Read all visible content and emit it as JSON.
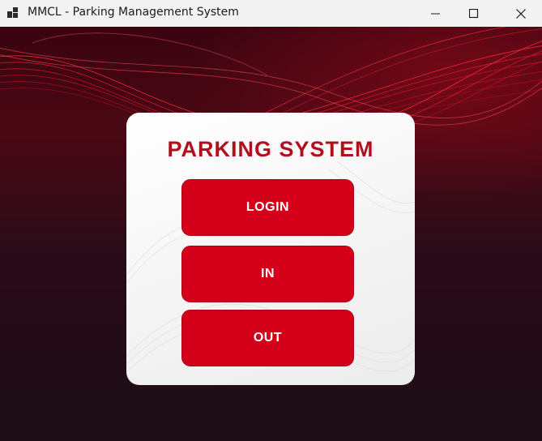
{
  "window": {
    "title": "MMCL - Parking Management System",
    "controls": {
      "minimize_icon": "minimize-icon",
      "maximize_icon": "maximize-icon",
      "close_icon": "close-icon"
    }
  },
  "panel": {
    "title": "PARKING SYSTEM",
    "buttons": [
      {
        "label": "LOGIN"
      },
      {
        "label": "IN"
      },
      {
        "label": "OUT"
      }
    ]
  },
  "colors": {
    "accent": "#d4001a",
    "title_red": "#b0101c",
    "background_dark": "#1f0e18",
    "wave_red": "#e0162a"
  }
}
